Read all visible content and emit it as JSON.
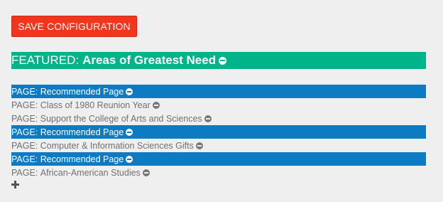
{
  "toolbar": {
    "save_label": "SAVE CONFIGURATION"
  },
  "featured": {
    "prefix": "FEATURED:",
    "title": "Areas of Greatest Need",
    "remove_icon": "minus-circle-icon"
  },
  "pages": [
    {
      "prefix": "PAGE:",
      "label": "Recommended Page",
      "highlighted": true
    },
    {
      "prefix": "PAGE:",
      "label": "Class of 1980 Reunion Year",
      "highlighted": false
    },
    {
      "prefix": "PAGE:",
      "label": "Support the College of Arts and Sciences",
      "highlighted": false
    },
    {
      "prefix": "PAGE:",
      "label": "Recommended Page",
      "highlighted": true
    },
    {
      "prefix": "PAGE:",
      "label": "Computer & Information Sciences Gifts",
      "highlighted": false
    },
    {
      "prefix": "PAGE:",
      "label": "Recommended Page",
      "highlighted": true
    },
    {
      "prefix": "PAGE:",
      "label": "African-American Studies",
      "highlighted": false
    }
  ],
  "add_icon": "plus-icon",
  "colors": {
    "save_button": "#f2361d",
    "featured_bg": "#00b48a",
    "highlight_bg": "#0d7bc4",
    "page_bg": "#efefef",
    "plain_text": "#707070"
  }
}
